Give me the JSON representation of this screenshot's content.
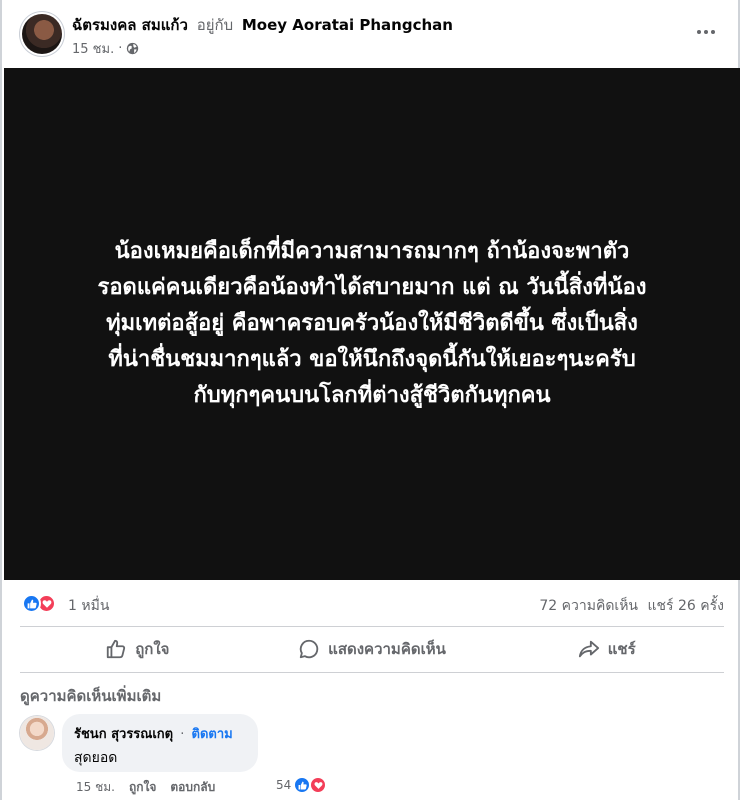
{
  "post": {
    "author": "ฉัตรมงคล สมแก้ว",
    "with_text": "อยู่กับ",
    "tagged": "Moey Aoratai Phangchan",
    "time": "15 ชม.",
    "separator": "·",
    "privacy_icon": "globe-icon",
    "image_text": "น้องเหมยคือเด็กที่มีความสามารถมากๆ ถ้าน้องจะพาตัว\nรอดแค่คนเดียวคือน้องทำได้สบายมาก แต่ ณ วันนี้สิ่งที่น้อง\nทุ่มเทต่อสู้อยู่ คือพาครอบครัวน้องให้มีชีวิตดีขึ้น ซึ่งเป็นสิ่ง\nที่น่าชื่นชมมากๆแล้ว ขอให้นึกถึงจุดนี้กันให้เยอะๆนะครับ\nกับทุกๆคนบนโลกที่ต่างสู้ชีวิตกันทุกคน",
    "image_background": "#111111"
  },
  "summary": {
    "reactions": "1 หมื่น",
    "comments": "72 ความคิดเห็น",
    "shares": "แชร์ 26 ครั้ง"
  },
  "actions": {
    "like": "ถูกใจ",
    "comment": "แสดงความคิดเห็น",
    "share": "แชร์"
  },
  "comments": {
    "view_more": "ดูความคิดเห็นเพิ่มเติม",
    "items": [
      {
        "author": "รัชนก สุวรรณเกตุ",
        "separator": "·",
        "follow": "ติดตาม",
        "text": "สุดยอด",
        "time": "15 ชม.",
        "like": "ถูกใจ",
        "reply": "ตอบกลับ",
        "reaction_count": "54"
      }
    ]
  },
  "colors": {
    "like_blue": "#1877f2",
    "love_red": "#f33e58",
    "secondary_text": "#65676b"
  }
}
